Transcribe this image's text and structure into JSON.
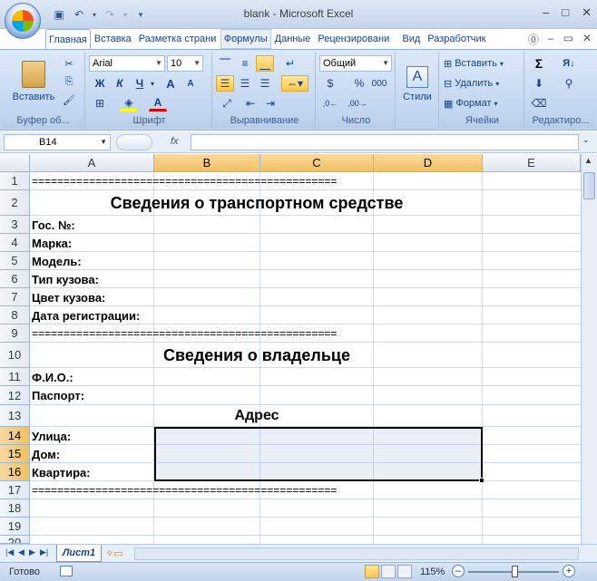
{
  "window": {
    "title": "blank - Microsoft Excel",
    "controls": [
      "–",
      "□",
      "✕"
    ]
  },
  "ribbon": {
    "tabs": [
      "Главная",
      "Вставка",
      "Разметка страни",
      "Формулы",
      "Данные",
      "Рецензировани",
      "Вид",
      "Разработчик"
    ],
    "active_tab": "Главная",
    "clipboard": {
      "paste_label": "Вставить",
      "group_label": "Буфер об..."
    },
    "font": {
      "name": "Arial",
      "size": "10",
      "bold": "Ж",
      "italic": "К",
      "underline": "Ч",
      "grow": "A",
      "shrink": "A",
      "group_label": "Шрифт"
    },
    "alignment": {
      "group_label": "Выравнивание"
    },
    "number": {
      "format": "Общий",
      "currency": "$",
      "percent": "%",
      "thousands": "000",
      "group_label": "Число"
    },
    "styles": {
      "label": "Стили"
    },
    "cells": {
      "insert": "Вставить",
      "delete": "Удалить",
      "format": "Формат",
      "group_label": "Ячейки"
    },
    "editing": {
      "sum": "Σ",
      "group_label": "Редактиро..."
    }
  },
  "formula_bar": {
    "name_box": "B14",
    "fx": "fx",
    "formula": ""
  },
  "columns": [
    "A",
    "B",
    "C",
    "D",
    "E"
  ],
  "selected_columns": [
    "B",
    "C",
    "D"
  ],
  "rows": [
    "1",
    "2",
    "3",
    "4",
    "5",
    "6",
    "7",
    "8",
    "9",
    "10",
    "11",
    "12",
    "13",
    "14",
    "15",
    "16",
    "17",
    "18",
    "19",
    "20"
  ],
  "selected_rows": [
    "14",
    "15",
    "16"
  ],
  "cells": {
    "r1": "================================================",
    "r2": "Сведения о транспортном средстве",
    "r3": "Гос. №:",
    "r4": "Марка:",
    "r5": "Модель:",
    "r6": "Тип кузова:",
    "r7": "Цвет кузова:",
    "r8": "Дата регистрации:",
    "r9": "================================================",
    "r10": "Сведения о владельце",
    "r11": "Ф.И.О.:",
    "r12": "Паспорт:",
    "r13": "Адрес",
    "r14": "Улица:",
    "r15": "Дом:",
    "r16": "Квартира:",
    "r17": "================================================"
  },
  "sheets": {
    "active": "Лист1"
  },
  "status": {
    "text": "Готово",
    "zoom": "115%"
  }
}
